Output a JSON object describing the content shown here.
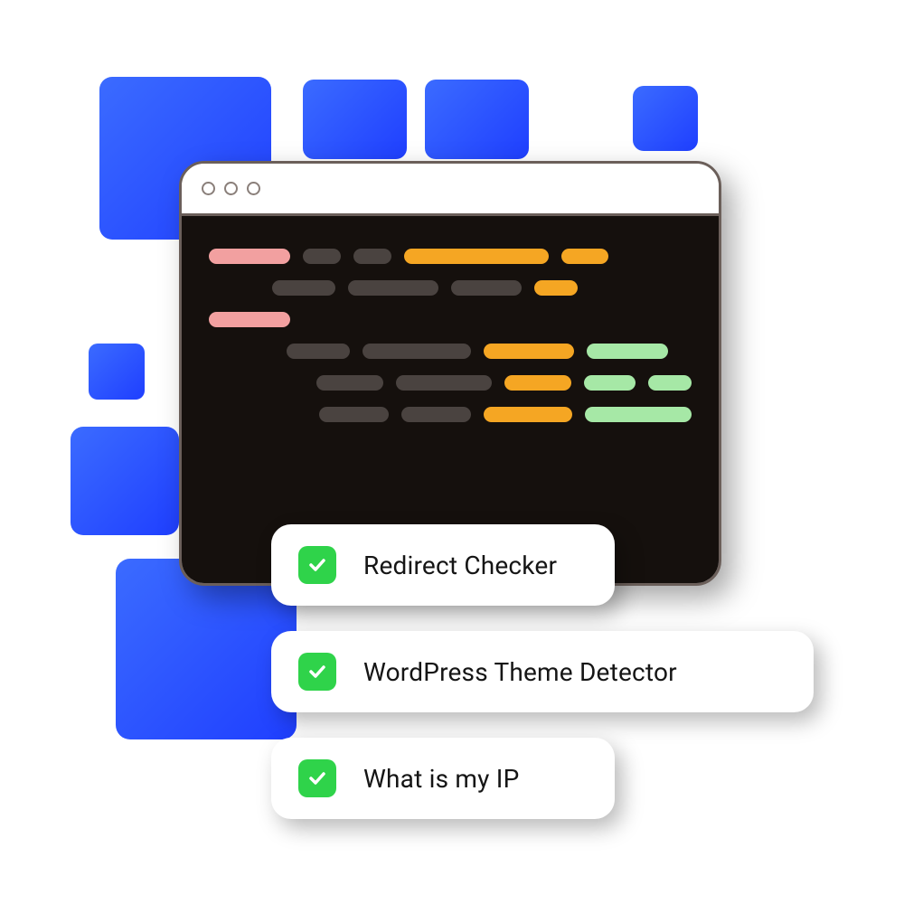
{
  "tools": [
    {
      "label": "Redirect Checker"
    },
    {
      "label": "WordPress Theme Detector"
    },
    {
      "label": "What is my IP"
    }
  ]
}
